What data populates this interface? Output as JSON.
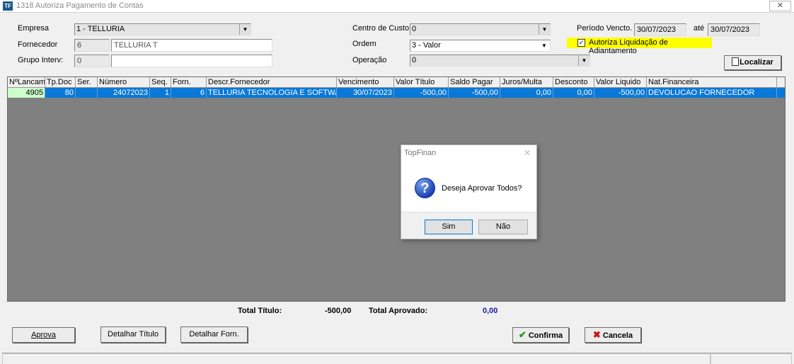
{
  "window": {
    "app_icon": "TF",
    "title": "1318 Autoriza Pagamento de Contas",
    "close": "✕"
  },
  "filters": {
    "empresa_label": "Empresa",
    "empresa_value": "1 - TELLURIA",
    "fornecedor_label": "Fornecedor",
    "fornecedor_code": "6",
    "fornecedor_name": "TELLURIA T",
    "grupo_label": "Grupo Interv:",
    "grupo_code": "0",
    "grupo_name": "",
    "centro_label": "Centro de Custo:",
    "centro_value": "0",
    "ordem_label": "Ordem",
    "ordem_value": "3 - Valor",
    "operacao_label": "Operação",
    "operacao_value": "0",
    "periodo_label": "Período Vencto.",
    "periodo_de": "30/07/2023",
    "ate_label": "até",
    "periodo_ate": "30/07/2023",
    "autoriza_label": "Autoriza Liquidação de Adiantamento",
    "autoriza_checked": "✓",
    "localizar_label": "Localizar"
  },
  "grid": {
    "headers": [
      "NºLancam",
      "Tp.Doc",
      "Ser.",
      "Número",
      "Seq.",
      "Forn.",
      "Descr.Fornecedor",
      "Vencimento",
      "Valor Título",
      "Saldo Pagar",
      "Juros/Multa",
      "Desconto",
      "Valor Liquido",
      "Nat.Financeira"
    ],
    "rows": [
      [
        "4905",
        "80",
        "",
        "24072023",
        "1",
        "6",
        "TELLURIA TECNOLOGIA E SOFTWARE",
        "30/07/2023",
        "-500,00",
        "-500,00",
        "0,00",
        "0,00",
        "-500,00",
        "DEVOLUCAO FORNECEDOR"
      ]
    ]
  },
  "dialog": {
    "title": "TopFinan",
    "close": "✕",
    "icon": "?",
    "message": "Deseja Aprovar Todos?",
    "yes": "Sim",
    "no": "Não"
  },
  "totals": {
    "total_titulo_label": "Total Título:",
    "total_titulo_value": "-500,00",
    "total_aprovado_label": "Total Aprovado:",
    "total_aprovado_value": "0,00"
  },
  "buttons": {
    "aprova": "Aprova",
    "detalhar_titulo": "Detalhar Título",
    "detalhar_forn": "Detalhar Forn.",
    "confirma": "Confirma",
    "cancela": "Cancela"
  },
  "colors": {
    "highlight": "#ffff00",
    "selection": "#0a78d7",
    "grid_background": "#808080",
    "total_aprovado": "#1a1aa0"
  },
  "icons": {
    "localizar": "search-doc-icon",
    "confirma": "check-icon",
    "cancela": "x-icon",
    "dialog": "question-icon"
  }
}
